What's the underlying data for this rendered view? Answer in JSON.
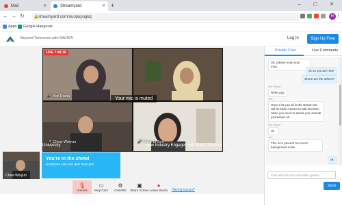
{
  "browser": {
    "tabs": [
      {
        "label": "Mail"
      },
      {
        "label": "Streamyard"
      }
    ],
    "url": "streamyard.com/ouopupogkq",
    "bookmarks": [
      {
        "label": "Apps"
      },
      {
        "label": "Google Hangouts"
      }
    ],
    "profile_initial": "R"
  },
  "app": {
    "event_title": "Beyond Tomorrow with MAHSA",
    "login_label": "Log In",
    "signup_label": "Sign Up Free"
  },
  "stage": {
    "live_badge": "LIVE 7:48:36",
    "muted_message": "Your mic is muted",
    "banner_left": "University",
    "banner_right": "How Industry Engages with Basic Science b",
    "participants": [
      {
        "name": "Nor Diana"
      },
      {
        "name": ""
      },
      {
        "name": "Chew Woiyun"
      },
      {
        "name": "Chen Li Sen"
      }
    ],
    "self_name": "Chew Woiyun",
    "show_title": "You're in the show!",
    "show_subtitle": "Everyone can see and hear you",
    "controls": [
      {
        "label": "Unmute",
        "icon": "mic-off-icon"
      },
      {
        "label": "Stop Cam",
        "icon": "camera-icon"
      },
      {
        "label": "Cam/Mic",
        "icon": "gear-icon"
      },
      {
        "label": "Share Screen",
        "icon": "monitor-icon"
      },
      {
        "label": "Leave Studio",
        "icon": "leave-icon"
      }
    ],
    "issues_link": "Having issues?"
  },
  "chat": {
    "tabs": [
      {
        "label": "Private Chat"
      },
      {
        "label": "Live Comments"
      }
    ],
    "messages": [
      {
        "sender": "",
        "text": "Ok. please mute your mics.",
        "side": "left"
      },
      {
        "sender": "",
        "text": "ok so you are here",
        "side": "right"
      },
      {
        "sender": "",
        "text": "where are the others?",
        "side": "right"
      },
      {
        "sender": "Nor Diana",
        "text": "Refer pg2",
        "side": "left"
      },
      {
        "sender": "Jen",
        "text": "Once I let you all in the stream we will let Mdm Azwani to talk first then when you need to speak you unmute yourselves ok",
        "side": "left"
      },
      {
        "sender": "Nor Diana",
        "text": "ok",
        "side": "left"
      },
      {
        "sender": "Jen",
        "text": "This is to prevent too much background noise",
        "side": "left"
      },
      {
        "sender": "",
        "text": "ok",
        "side": "right"
      }
    ],
    "input_placeholder": "Chat with the host and other guests",
    "send_label": "Send"
  },
  "colors": {
    "accent": "#1e88e5",
    "live": "#e53935",
    "show_box": "#29b6f6"
  }
}
